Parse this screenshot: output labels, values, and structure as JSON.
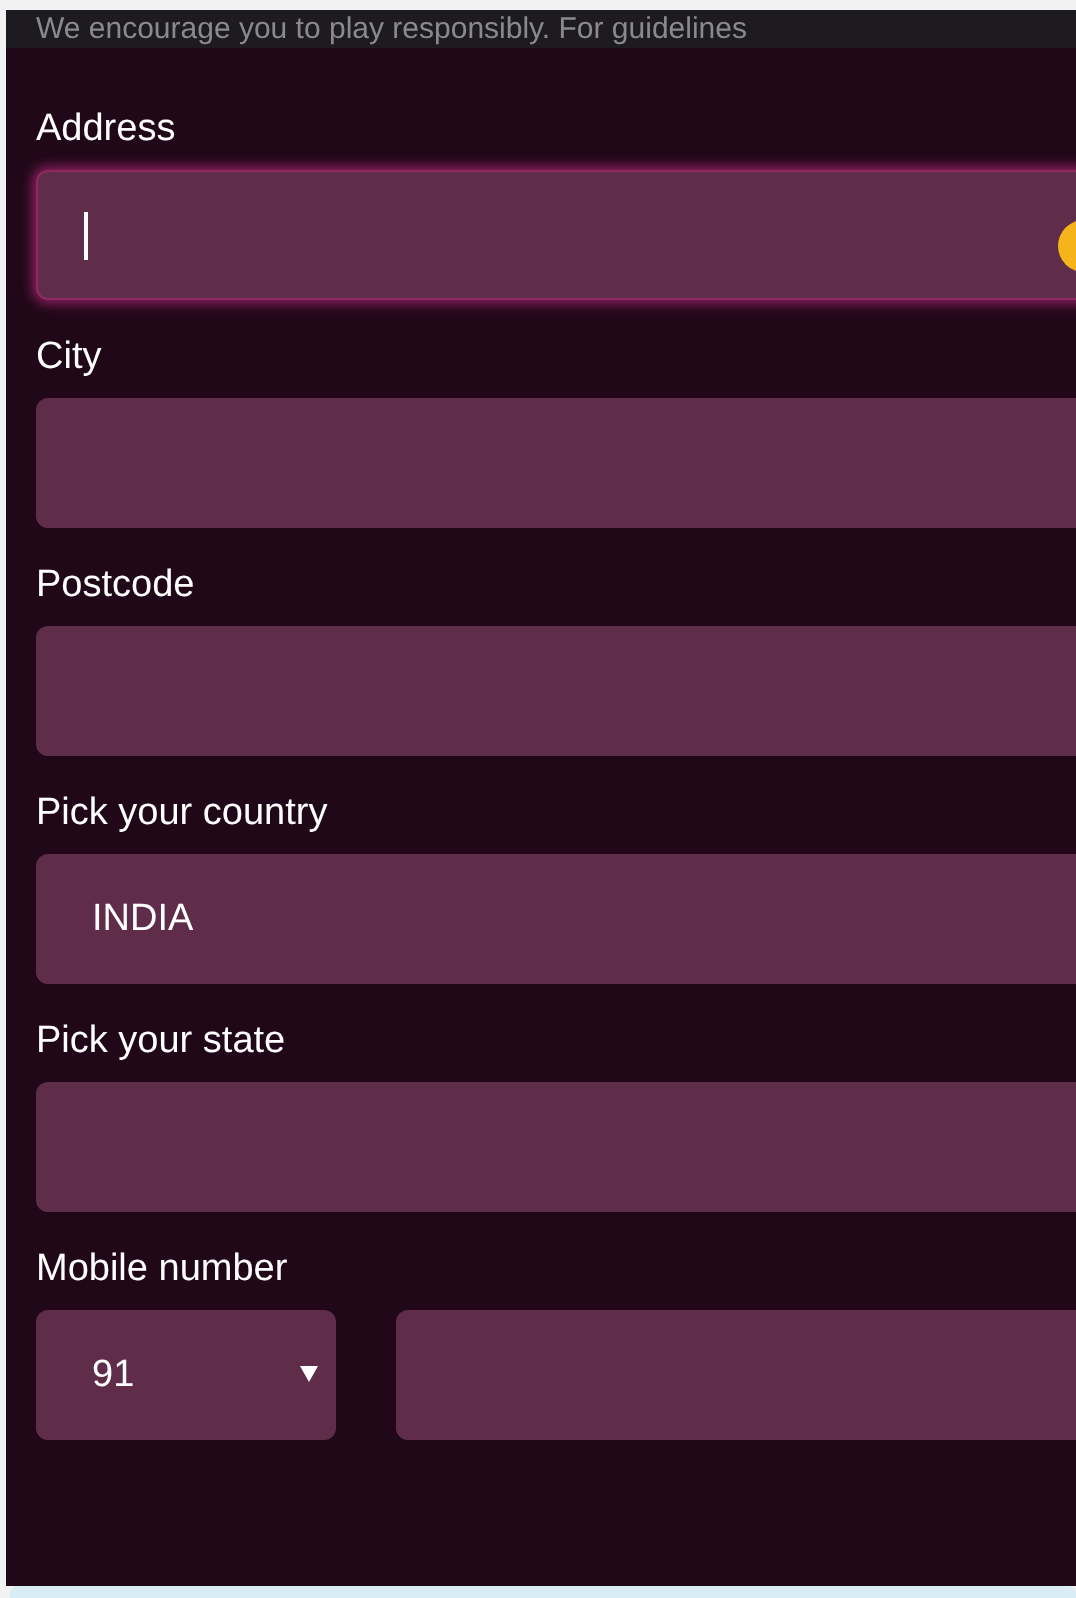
{
  "notice": "We encourage you to play responsibly. For guidelines",
  "fields": [
    {
      "label": "Address",
      "kind": "text",
      "focused": true
    },
    {
      "label": "City",
      "kind": "text",
      "focused": false
    },
    {
      "label": "Postcode",
      "kind": "text",
      "focused": false
    },
    {
      "label": "Pick your country",
      "kind": "select",
      "value": "INDIA",
      "focused": false
    },
    {
      "label": "Pick your state",
      "kind": "select",
      "focused": false
    },
    {
      "label": "Mobile number",
      "kind": "phone",
      "code": "91",
      "focused": false
    }
  ]
}
